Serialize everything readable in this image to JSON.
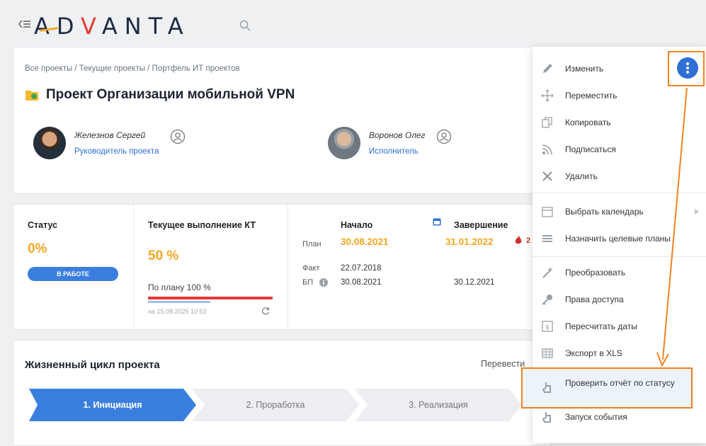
{
  "app": {
    "logo_text_1": "A",
    "logo_text_2": "D",
    "logo_text_3": "V",
    "logo_text_4": "A",
    "logo_text_5": "N",
    "logo_text_6": "T",
    "logo_text_7": "A"
  },
  "breadcrumb": "Все проекты / Текущие проекты / Портфель ИТ проектов",
  "project_title": "Проект Организации мобильной VPN",
  "people": [
    {
      "name": "Железнов Сергей",
      "role": "Руководитель проекта"
    },
    {
      "name": "Воронов Олег",
      "role": "Исполнитель"
    }
  ],
  "stats": {
    "status_title": "Статус",
    "status_value": "0%",
    "status_pill": "В РАБОТЕ",
    "kt_title": "Текущее выполнение КТ",
    "kt_value": "50 %",
    "plan_text": "По плану  100 %",
    "updated": "на 15.08.2025 10:53",
    "progress_actual": 1.0,
    "progress_plan": 0.5
  },
  "dates": {
    "start_header": "Начало",
    "end_header": "Завершение",
    "plan_label": "План",
    "fact_label": "Факт",
    "bp_label": "БП",
    "plan_start": "30.08.2021",
    "plan_end": "31.01.2022",
    "plan_end_extra": "2",
    "fact_start": "22.07.2018",
    "bp_start": "30.08.2021",
    "bp_end": "30.12.2021"
  },
  "lifecycle": {
    "title": "Жизненный цикл проекта",
    "link": "Перевести",
    "stages": [
      "1. Инициация",
      "2. Проработка",
      "3. Реализация"
    ]
  },
  "menu": {
    "items": [
      {
        "label": "Изменить",
        "icon": "pencil-icon"
      },
      {
        "label": "Переместить",
        "icon": "move-icon"
      },
      {
        "label": "Копировать",
        "icon": "copy-icon"
      },
      {
        "label": "Подписаться",
        "icon": "rss-icon"
      },
      {
        "label": "Удалить",
        "icon": "close-icon"
      },
      {
        "label": "Выбрать календарь",
        "icon": "calendar-icon"
      },
      {
        "label": "Назначить целевые планы",
        "icon": "plans-icon"
      },
      {
        "label": "Преобразовать",
        "icon": "wand-icon"
      },
      {
        "label": "Права доступа",
        "icon": "key-icon"
      },
      {
        "label": "Пересчитать даты",
        "icon": "recalc-icon"
      },
      {
        "label": "Экспорт в XLS",
        "icon": "table-icon"
      },
      {
        "label": "Проверить отчёт по статусу",
        "icon": "hand-icon"
      },
      {
        "label": "Запуск события",
        "icon": "hand-icon"
      }
    ]
  },
  "colors": {
    "accent": "#2f6fd6",
    "orange": "#f5a623",
    "highlight": "#f58220",
    "red": "#e53935"
  }
}
